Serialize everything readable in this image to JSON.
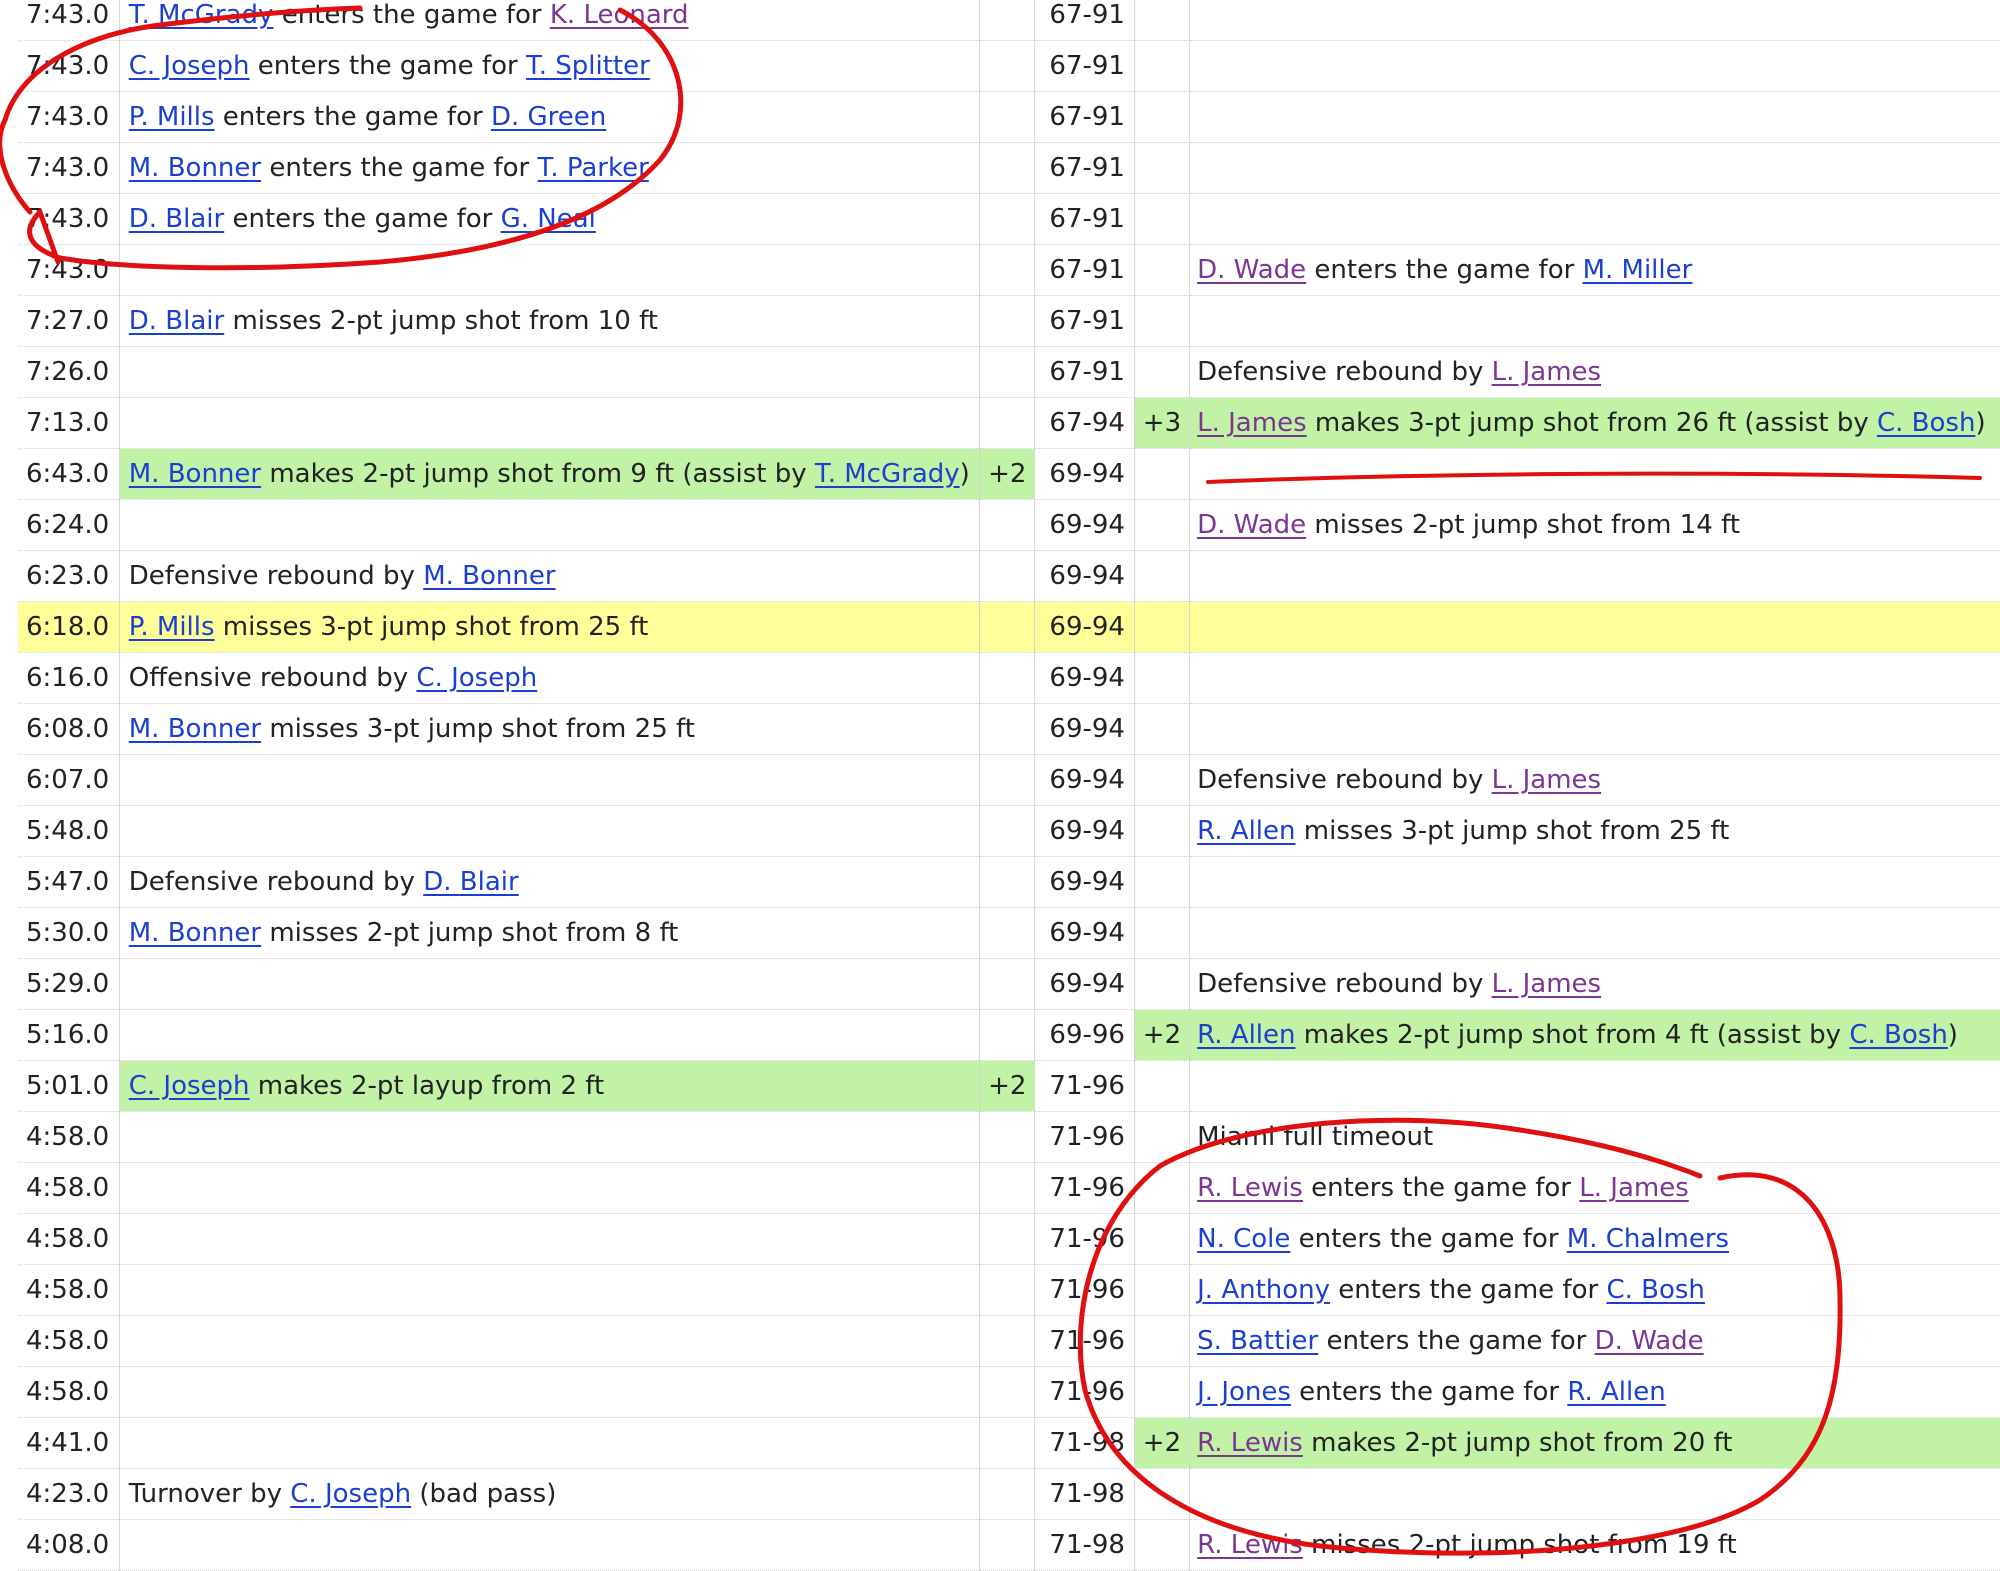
{
  "rows": [
    {
      "time": "7:43.0",
      "away": [
        {
          "p": "T. McGrady",
          "c": "blue"
        },
        {
          "t": " enters the game for "
        },
        {
          "p": "K. Leonard",
          "c": "purple"
        }
      ],
      "score": "67-91"
    },
    {
      "time": "7:43.0",
      "away": [
        {
          "p": "C. Joseph",
          "c": "blue"
        },
        {
          "t": " enters the game for "
        },
        {
          "p": "T. Splitter",
          "c": "blue"
        }
      ],
      "score": "67-91"
    },
    {
      "time": "7:43.0",
      "away": [
        {
          "p": "P. Mills",
          "c": "blue"
        },
        {
          "t": " enters the game for "
        },
        {
          "p": "D. Green",
          "c": "blue"
        }
      ],
      "score": "67-91"
    },
    {
      "time": "7:43.0",
      "away": [
        {
          "p": "M. Bonner",
          "c": "blue"
        },
        {
          "t": " enters the game for "
        },
        {
          "p": "T. Parker",
          "c": "blue"
        }
      ],
      "score": "67-91"
    },
    {
      "time": "7:43.0",
      "away": [
        {
          "p": "D. Blair",
          "c": "blue"
        },
        {
          "t": " enters the game for "
        },
        {
          "p": "G. Neal",
          "c": "blue"
        }
      ],
      "score": "67-91"
    },
    {
      "time": "7:43.0",
      "score": "67-91",
      "home": [
        {
          "p": "D. Wade",
          "c": "purple"
        },
        {
          "t": " enters the game for "
        },
        {
          "p": "M. Miller",
          "c": "blue"
        }
      ]
    },
    {
      "time": "7:27.0",
      "away": [
        {
          "p": "D. Blair",
          "c": "blue"
        },
        {
          "t": " misses 2-pt jump shot from 10 ft"
        }
      ],
      "score": "67-91"
    },
    {
      "time": "7:26.0",
      "score": "67-91",
      "home": [
        {
          "t": "Defensive rebound by "
        },
        {
          "p": "L. James",
          "c": "purple"
        }
      ]
    },
    {
      "time": "7:13.0",
      "score": "67-94",
      "home_pts": "+3",
      "home_made": true,
      "home": [
        {
          "p": "L. James",
          "c": "purple"
        },
        {
          "t": " makes 3-pt jump shot from 26 ft (assist by "
        },
        {
          "p": "C. Bosh",
          "c": "blue"
        },
        {
          "t": ")"
        }
      ]
    },
    {
      "time": "6:43.0",
      "away_made": true,
      "away_pts": "+2",
      "away": [
        {
          "p": "M. Bonner",
          "c": "blue"
        },
        {
          "t": " makes 2-pt jump shot from 9 ft (assist by "
        },
        {
          "p": "T. McGrady",
          "c": "blue"
        },
        {
          "t": ")"
        }
      ],
      "score": "69-94"
    },
    {
      "time": "6:24.0",
      "score": "69-94",
      "home": [
        {
          "p": "D. Wade",
          "c": "purple"
        },
        {
          "t": " misses 2-pt jump shot from 14 ft"
        }
      ]
    },
    {
      "time": "6:23.0",
      "away": [
        {
          "t": "Defensive rebound by "
        },
        {
          "p": "M. Bonner",
          "c": "blue"
        }
      ],
      "score": "69-94"
    },
    {
      "time": "6:18.0",
      "highlight": true,
      "away": [
        {
          "p": "P. Mills",
          "c": "blue"
        },
        {
          "t": " misses 3-pt jump shot from 25 ft"
        }
      ],
      "score": "69-94"
    },
    {
      "time": "6:16.0",
      "away": [
        {
          "t": "Offensive rebound by "
        },
        {
          "p": "C. Joseph",
          "c": "blue"
        }
      ],
      "score": "69-94"
    },
    {
      "time": "6:08.0",
      "away": [
        {
          "p": "M. Bonner",
          "c": "blue"
        },
        {
          "t": " misses 3-pt jump shot from 25 ft"
        }
      ],
      "score": "69-94"
    },
    {
      "time": "6:07.0",
      "score": "69-94",
      "home": [
        {
          "t": "Defensive rebound by "
        },
        {
          "p": "L. James",
          "c": "purple"
        }
      ]
    },
    {
      "time": "5:48.0",
      "score": "69-94",
      "home": [
        {
          "p": "R. Allen",
          "c": "blue"
        },
        {
          "t": " misses 3-pt jump shot from 25 ft"
        }
      ]
    },
    {
      "time": "5:47.0",
      "away": [
        {
          "t": "Defensive rebound by "
        },
        {
          "p": "D. Blair",
          "c": "blue"
        }
      ],
      "score": "69-94"
    },
    {
      "time": "5:30.0",
      "away": [
        {
          "p": "M. Bonner",
          "c": "blue"
        },
        {
          "t": " misses 2-pt jump shot from 8 ft"
        }
      ],
      "score": "69-94"
    },
    {
      "time": "5:29.0",
      "score": "69-94",
      "home": [
        {
          "t": "Defensive rebound by "
        },
        {
          "p": "L. James",
          "c": "purple"
        }
      ]
    },
    {
      "time": "5:16.0",
      "score": "69-96",
      "home_pts": "+2",
      "home_made": true,
      "home": [
        {
          "p": "R. Allen",
          "c": "blue"
        },
        {
          "t": " makes 2-pt jump shot from 4 ft (assist by "
        },
        {
          "p": "C. Bosh",
          "c": "blue"
        },
        {
          "t": ")"
        }
      ]
    },
    {
      "time": "5:01.0",
      "away_made": true,
      "away_pts": "+2",
      "away": [
        {
          "p": "C. Joseph",
          "c": "blue"
        },
        {
          "t": " makes 2-pt layup from 2 ft"
        }
      ],
      "score": "71-96"
    },
    {
      "time": "4:58.0",
      "score": "71-96",
      "home": [
        {
          "t": "Miami full timeout"
        }
      ]
    },
    {
      "time": "4:58.0",
      "score": "71-96",
      "home": [
        {
          "p": "R. Lewis",
          "c": "purple"
        },
        {
          "t": " enters the game for "
        },
        {
          "p": "L. James",
          "c": "purple"
        }
      ]
    },
    {
      "time": "4:58.0",
      "score": "71-96",
      "home": [
        {
          "p": "N. Cole",
          "c": "blue"
        },
        {
          "t": " enters the game for "
        },
        {
          "p": "M. Chalmers",
          "c": "blue"
        }
      ]
    },
    {
      "time": "4:58.0",
      "score": "71-96",
      "home": [
        {
          "p": "J. Anthony",
          "c": "blue"
        },
        {
          "t": " enters the game for "
        },
        {
          "p": "C. Bosh",
          "c": "blue"
        }
      ]
    },
    {
      "time": "4:58.0",
      "score": "71-96",
      "home": [
        {
          "p": "S. Battier",
          "c": "blue"
        },
        {
          "t": " enters the game for "
        },
        {
          "p": "D. Wade",
          "c": "purple"
        }
      ]
    },
    {
      "time": "4:58.0",
      "score": "71-96",
      "home": [
        {
          "p": "J. Jones",
          "c": "blue"
        },
        {
          "t": " enters the game for "
        },
        {
          "p": "R. Allen",
          "c": "blue"
        }
      ]
    },
    {
      "time": "4:41.0",
      "score": "71-98",
      "home_pts": "+2",
      "home_made": true,
      "home": [
        {
          "p": "R. Lewis",
          "c": "purple"
        },
        {
          "t": " makes 2-pt jump shot from 20 ft"
        }
      ]
    },
    {
      "time": "4:23.0",
      "away": [
        {
          "t": "Turnover by "
        },
        {
          "p": "C. Joseph",
          "c": "blue"
        },
        {
          "t": " (bad pass)"
        }
      ],
      "score": "71-98"
    },
    {
      "time": "4:08.0",
      "score": "71-98",
      "home": [
        {
          "p": "R. Lewis",
          "c": "purple"
        },
        {
          "t": " misses 2-pt jump shot from 19 ft"
        }
      ]
    }
  ],
  "colors": {
    "link_blue": "#1a3fd1",
    "link_purple": "#7b3593",
    "made_shot_bg": "#c2f2a5",
    "highlight_row_bg": "#ffff99",
    "annotation_red": "#e01010"
  }
}
